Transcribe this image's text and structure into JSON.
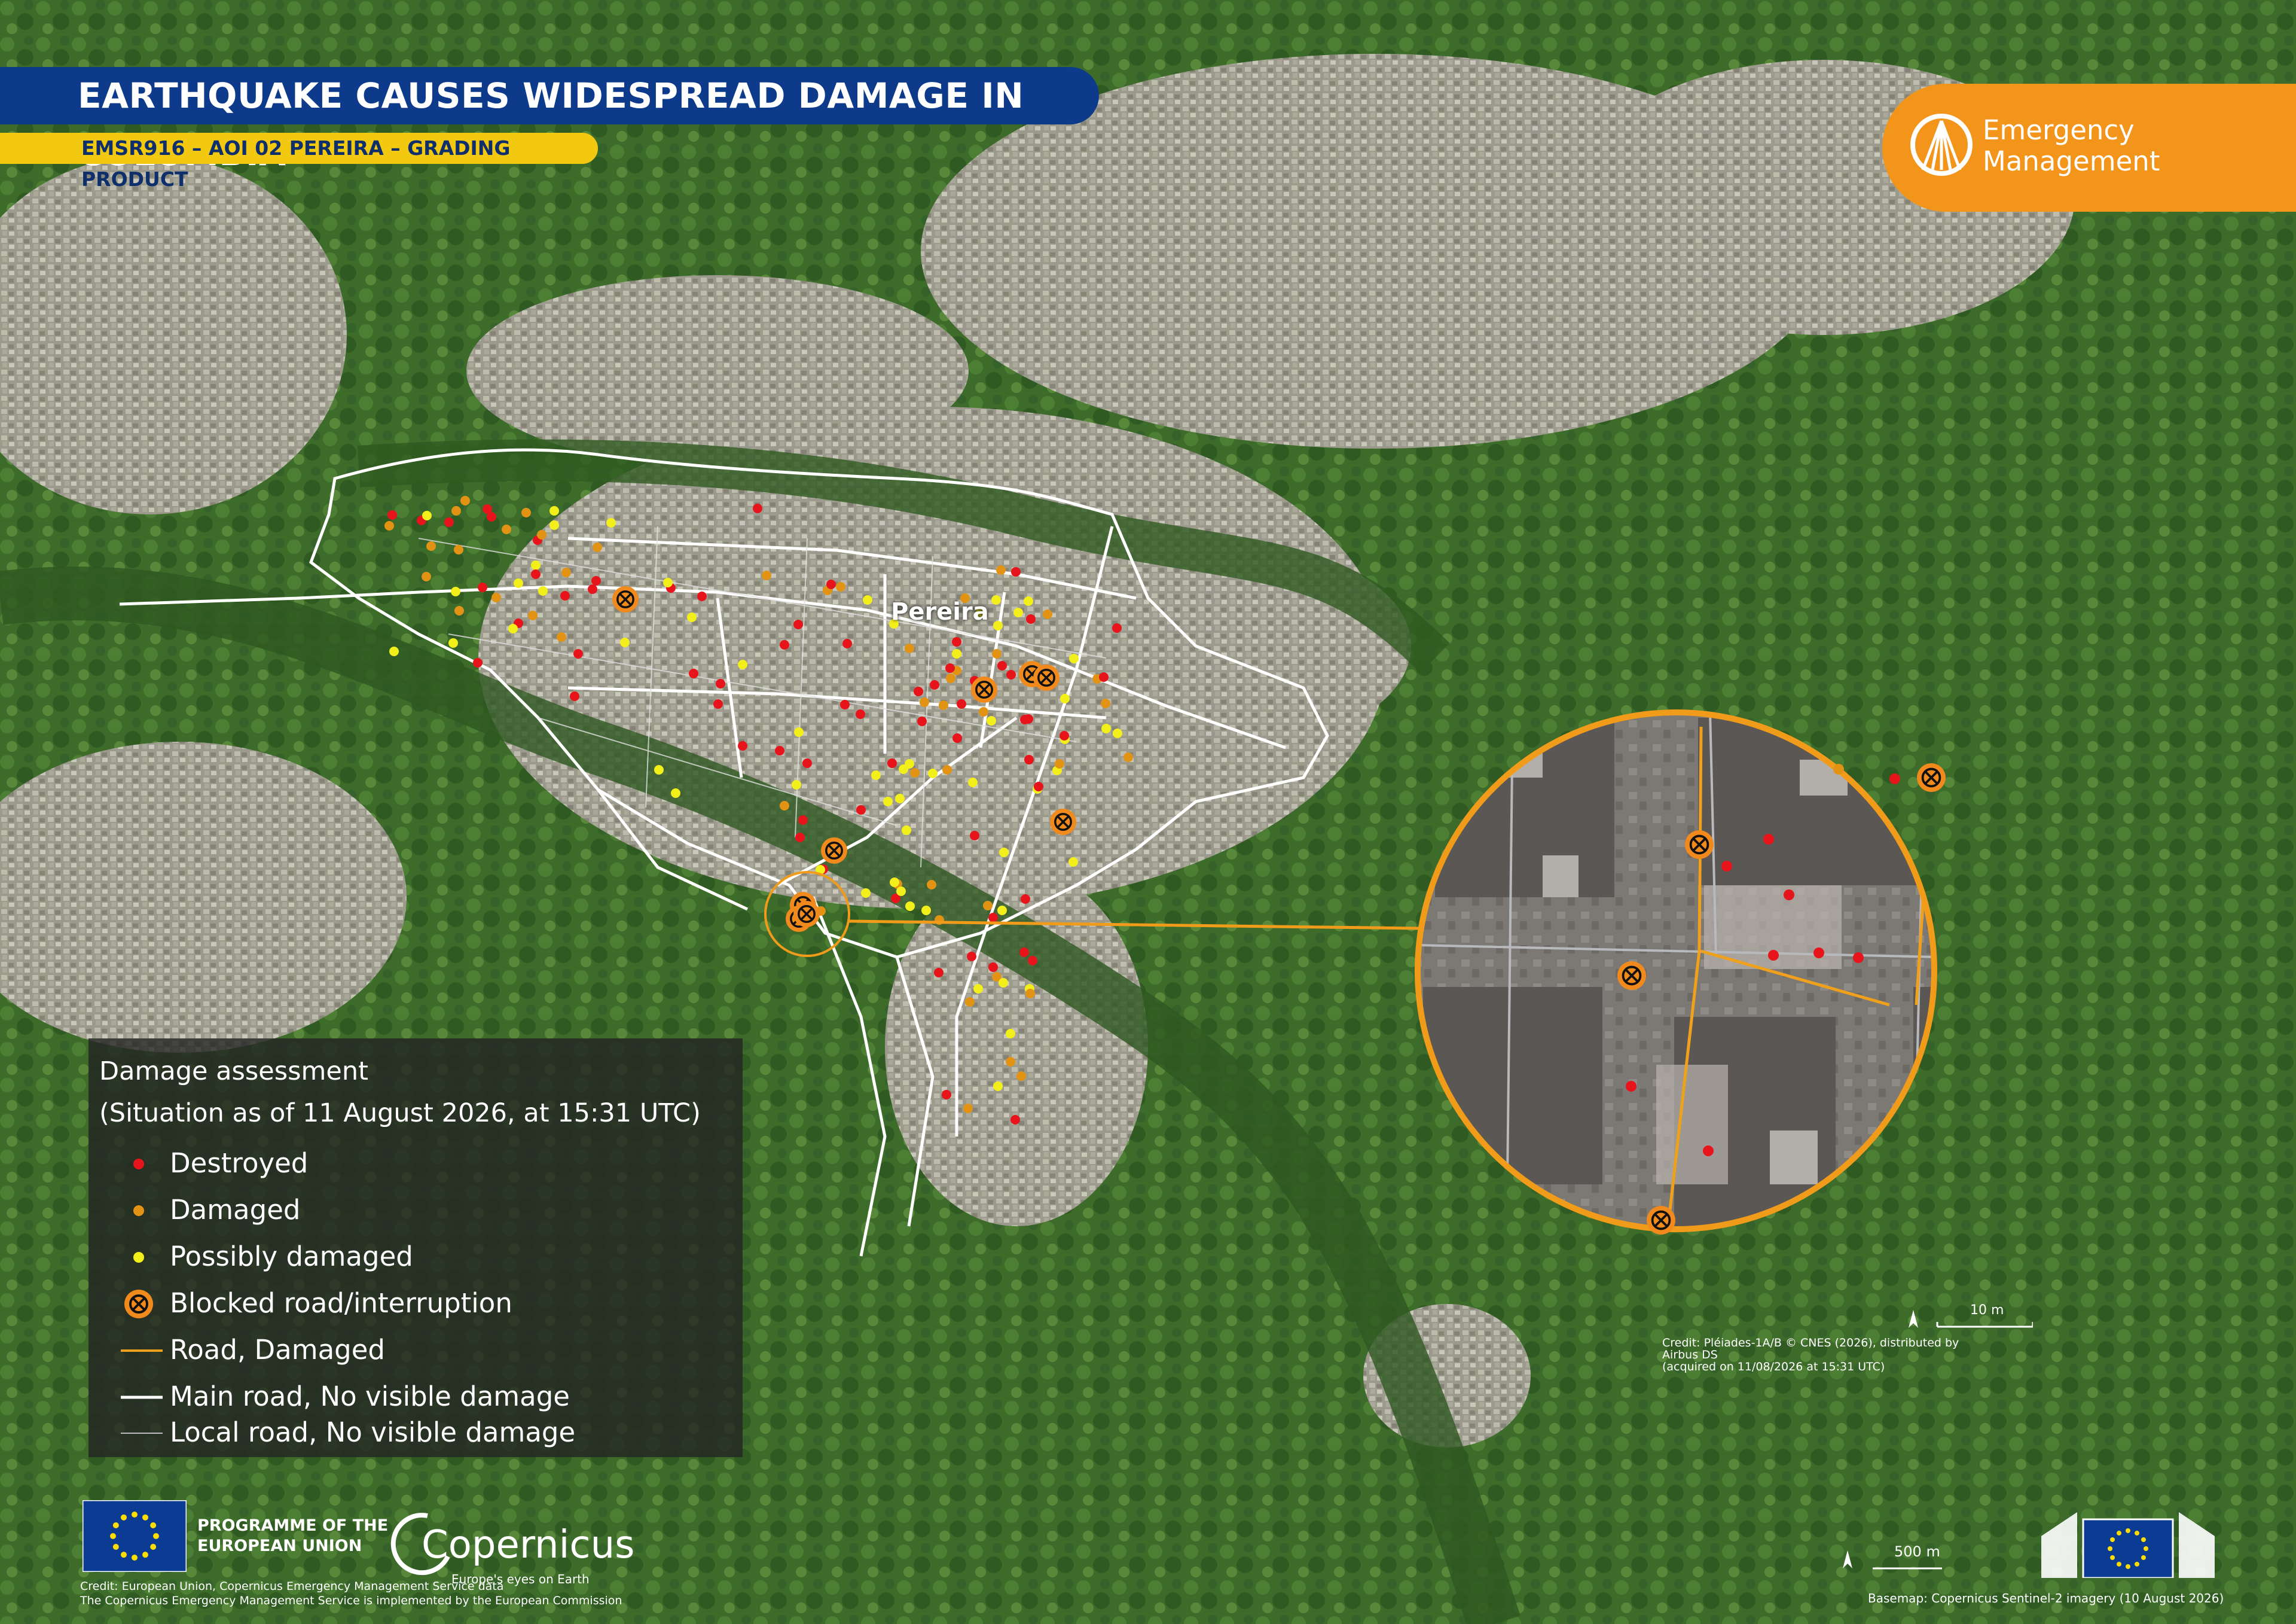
{
  "header": {
    "title": "EARTHQUAKE CAUSES WIDESPREAD DAMAGE IN COLOMBIA",
    "subtitle": "EMSR916 – AOI 02 PEREIRA – GRADING PRODUCT"
  },
  "logo": {
    "line1": "Emergency",
    "line2": "Management"
  },
  "map": {
    "city_label": "Pereira",
    "colors": {
      "destroyed": "#e8141b",
      "damaged": "#e39314",
      "possibly_damaged": "#f3ef1b",
      "blocked": "#f08a1c",
      "road_damaged": "#f0a11c",
      "main_road": "#ffffff",
      "local_road": "#d0d0d0"
    }
  },
  "legend": {
    "title_line1": "Damage assessment",
    "title_line2": "(Situation as of 11 August 2026, at 15:31 UTC)",
    "items": [
      {
        "label": "Destroyed",
        "symbol": "dot-red"
      },
      {
        "label": "Damaged",
        "symbol": "dot-orange"
      },
      {
        "label": "Possibly damaged",
        "symbol": "dot-yellow"
      },
      {
        "label": "Blocked road/interruption",
        "symbol": "blocked-road-icon"
      },
      {
        "label": "Road, Damaged",
        "symbol": "line-orange"
      },
      {
        "label": "Main road, No visible damage",
        "symbol": "line-white"
      },
      {
        "label": "Local road, No visible damage",
        "symbol": "line-grey"
      }
    ]
  },
  "zoom": {
    "scale_label": "10 m",
    "credit_line1": "Credit: Pléiades-1A/B © CNES (2026), distributed by Airbus DS",
    "credit_line2": "(acquired on 11/08/2026 at 15:31 UTC)"
  },
  "footer": {
    "programme_line1": "PROGRAMME OF THE",
    "programme_line2": "EUROPEAN UNION",
    "copernicus_name": "Copernicus",
    "copernicus_tag": "Europe's eyes on Earth",
    "credit_line1": "Credit: European Union, Copernicus Emergency Management Service data",
    "credit_line2": "The Copernicus Emergency Management Service is implemented by the European Commission",
    "scale_label": "500 m",
    "basemap": "Basemap: Copernicus Sentinel-2 imagery (10 August 2026)"
  }
}
